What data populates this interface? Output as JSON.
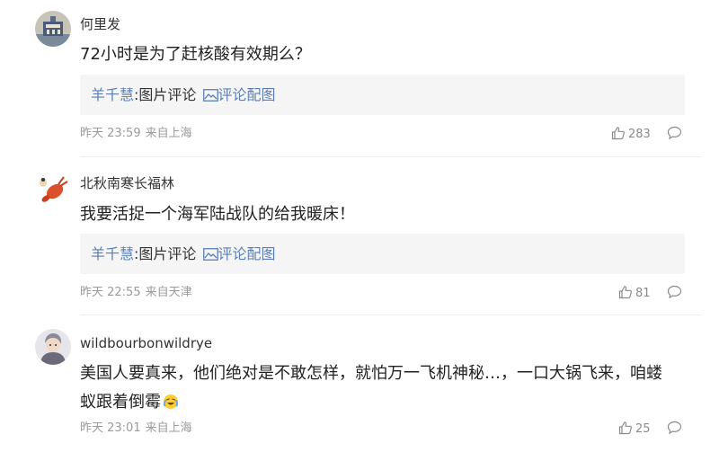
{
  "comments": [
    {
      "username": "何里发",
      "text": "72小时是为了赶核酸有效期么？",
      "quote": {
        "author": "羊千慧",
        "sep": ":",
        "text": "图片评论",
        "link": "评论配图"
      },
      "time": "昨天 23:59",
      "location": "来自上海",
      "likes": "283",
      "avatar_icon": "monument-avatar"
    },
    {
      "username": "北秋南寒长福林",
      "text": "我要活捉一个海军陆战队的给我暖床！",
      "quote": {
        "author": "羊千慧",
        "sep": ":",
        "text": "图片评论",
        "link": "评论配图"
      },
      "time": "昨天 22:55",
      "location": "来自天津",
      "likes": "81",
      "avatar_icon": "lobster-avatar"
    },
    {
      "username": "wildbourbonwildrye",
      "text": "美国人要真来，他们绝对是不敢怎样，就怕万一飞机神秘…，一口大锅飞来，咱蝼蚁跟着倒霉",
      "emoji": "laughing-crying-emoji",
      "time": "昨天 23:01",
      "location": "来自上海",
      "likes": "25",
      "avatar_icon": "portrait-avatar"
    }
  ],
  "colors": {
    "link": "#5b7fb5",
    "meta": "#9a9a9a",
    "quote_bg": "#f5f5f5",
    "divider": "#eeeeee"
  }
}
